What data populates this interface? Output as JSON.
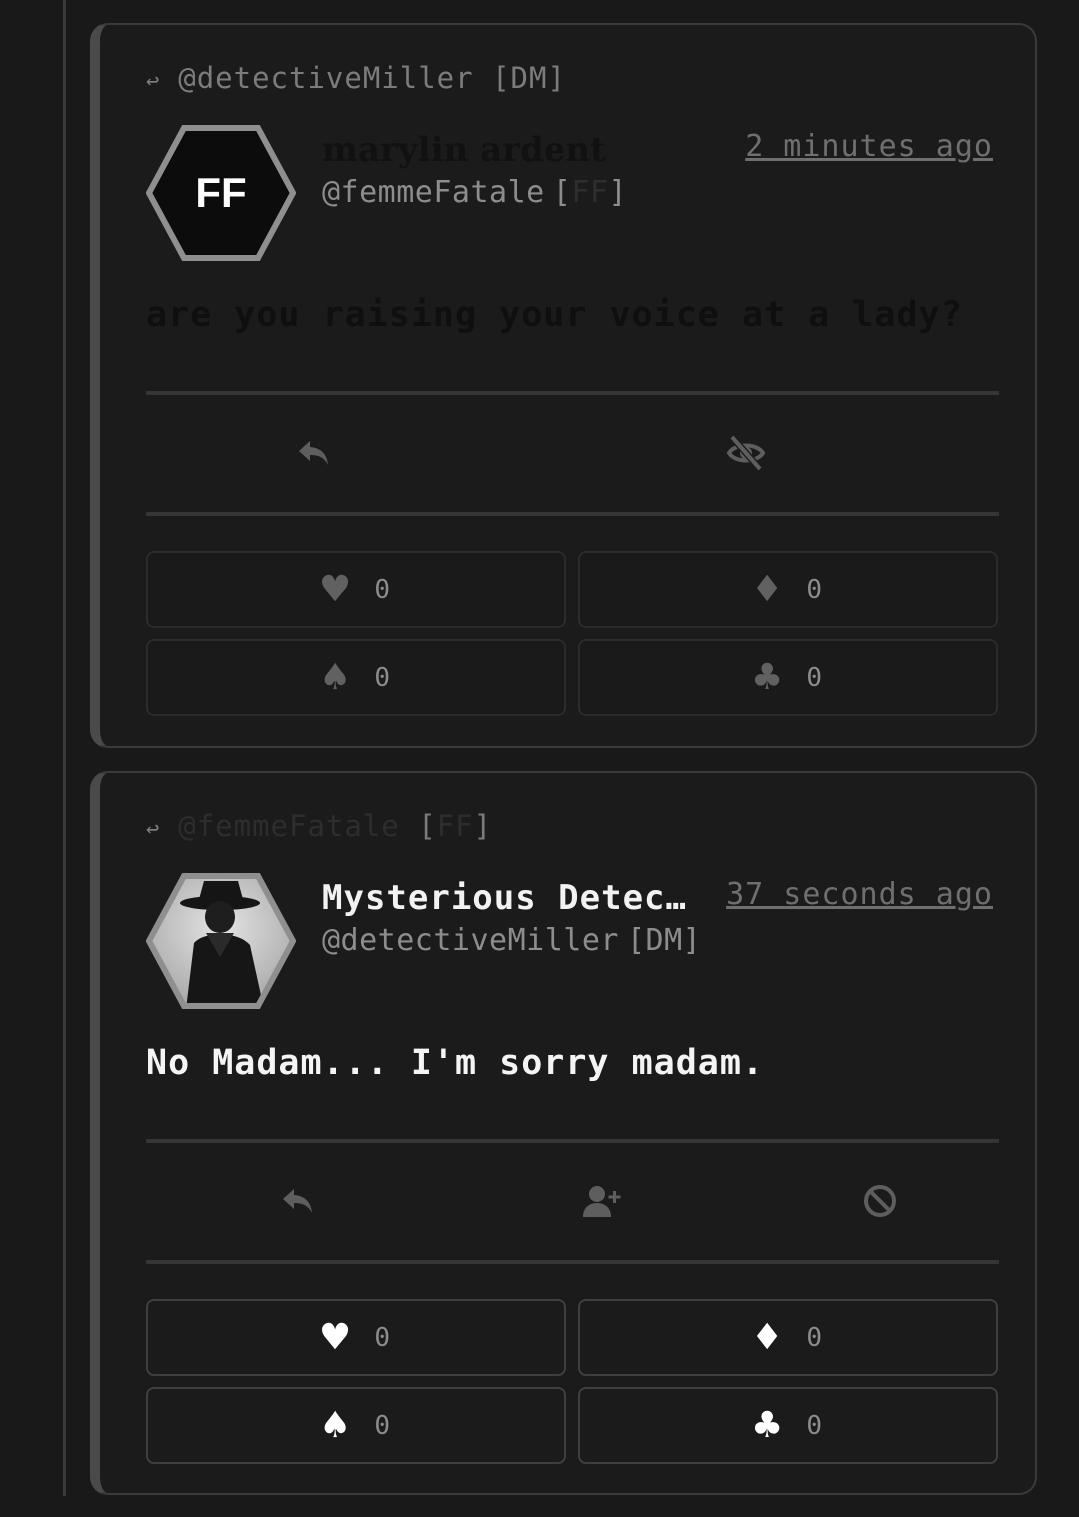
{
  "posts": [
    {
      "reply_to_handle": "@detectiveMiller",
      "reply_to_tag_open": "[",
      "reply_to_tag": "DM",
      "reply_to_tag_close": "]",
      "avatar_initials": "FF",
      "display_name": "marylin ardent",
      "handle": "@femmeFatale",
      "tag_open": "[",
      "tag": "FF",
      "tag_close": "]",
      "time": "2 minutes ago",
      "body": "are you raising your voice at a lady?",
      "actions": [
        "reply-icon",
        "eye-slash-icon"
      ],
      "reactions": {
        "heart": "0",
        "diamond": "0",
        "spade": "0",
        "club": "0"
      }
    },
    {
      "reply_to_handle": "@femmeFatale",
      "reply_to_tag_open": "[",
      "reply_to_tag": "FF",
      "reply_to_tag_close": "]",
      "display_name": "Mysterious Detec…",
      "handle": "@detectiveMiller",
      "tag_open": "[",
      "tag": "DM",
      "tag_close": "]",
      "time": "37 seconds ago",
      "body": "No Madam... I'm sorry madam.",
      "actions": [
        "reply-icon",
        "add-user-icon",
        "block-icon"
      ],
      "reactions": {
        "heart": "0",
        "diamond": "0",
        "spade": "0",
        "club": "0"
      }
    }
  ],
  "suits": {
    "heart": "♥",
    "diamond": "♦",
    "spade": "♠",
    "club": "♣"
  },
  "reply_arrow": "↩"
}
